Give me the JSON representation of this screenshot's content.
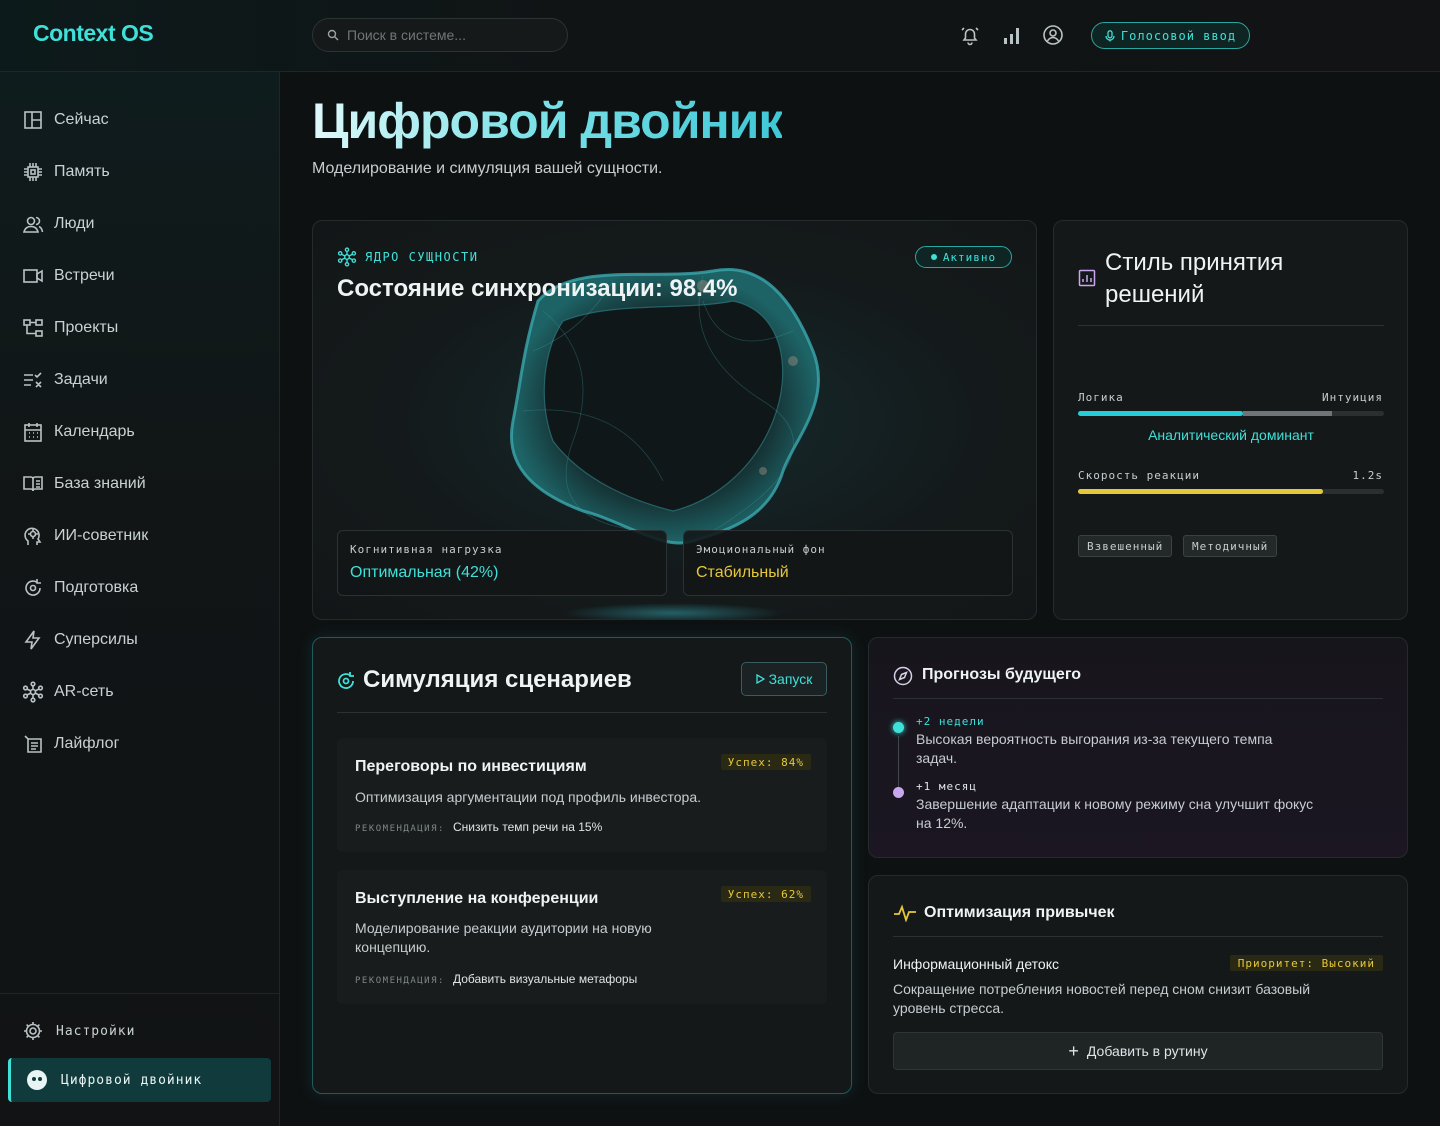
{
  "app": {
    "logo": "Context OS"
  },
  "header": {
    "search_placeholder": "Поиск в системе...",
    "voice_label": "Голосовой ввод"
  },
  "sidebar": {
    "items": [
      {
        "label": "Сейчас",
        "icon": "layout-icon"
      },
      {
        "label": "Память",
        "icon": "chip-icon"
      },
      {
        "label": "Люди",
        "icon": "people-icon"
      },
      {
        "label": "Встречи",
        "icon": "video-icon"
      },
      {
        "label": "Проекты",
        "icon": "hierarchy-icon"
      },
      {
        "label": "Задачи",
        "icon": "tasks-icon"
      },
      {
        "label": "Календарь",
        "icon": "calendar-icon"
      },
      {
        "label": "База знаний",
        "icon": "book-icon"
      },
      {
        "label": "ИИ-советник",
        "icon": "ai-head-icon"
      },
      {
        "label": "Подготовка",
        "icon": "refresh-icon"
      },
      {
        "label": "Суперсилы",
        "icon": "bolt-icon"
      },
      {
        "label": "AR-сеть",
        "icon": "network-icon"
      },
      {
        "label": "Лайфлог",
        "icon": "log-icon"
      }
    ],
    "settings": "Настройки",
    "active": "Цифровой двойник"
  },
  "page": {
    "title": "Цифровой двойник",
    "subtitle": "Моделирование и симуляция вашей сущности."
  },
  "core": {
    "label": "ЯДРО СУЩНОСТИ",
    "status": "Активно",
    "sync": "Состояние синхронизации: 98.4%",
    "metrics": [
      {
        "label": "Когнитивная нагрузка",
        "value": "Оптимальная (42%)",
        "color": "#3fe0d8"
      },
      {
        "label": "Эмоциональный фон",
        "value": "Стабильный",
        "color": "#e7c73a"
      }
    ]
  },
  "decision": {
    "title": "Стиль принятия решений",
    "left_label": "Логика",
    "right_label": "Интуиция",
    "logic_fraction": 0.54,
    "dominant": "Аналитический доминант",
    "speed_label": "Скорость реакции",
    "speed_value": "1.2s",
    "speed_fraction": 0.8,
    "tags": [
      "Взвешенный",
      "Методичный"
    ]
  },
  "simulation": {
    "title": "Симуляция сценариев",
    "run_label": "Запуск",
    "rec_key": "РЕКОМЕНДАЦИЯ:",
    "scenarios": [
      {
        "title": "Переговоры по инвестициям",
        "success": "Успех: 84%",
        "desc": "Оптимизация аргументации под профиль инвестора.",
        "rec": "Снизить темп речи на 15%"
      },
      {
        "title": "Выступление на конференции",
        "success": "Успех: 62%",
        "desc": "Моделирование реакции аудитории на новую концепцию.",
        "rec": "Добавить визуальные метафоры"
      }
    ]
  },
  "forecast": {
    "title": "Прогнозы будущего",
    "items": [
      {
        "when": "+2 недели",
        "text": "Высокая вероятность выгорания из-за текущего темпа задач.",
        "color": "#3fe0d8"
      },
      {
        "when": "+1 месяц",
        "text": "Завершение адаптации к новому режиму сна улучшит фокус на 12%.",
        "color": "#c9a6f0"
      }
    ]
  },
  "habits": {
    "title": "Оптимизация привычек",
    "name": "Информационный детокс",
    "priority": "Приоритет: Высокий",
    "desc": "Сокращение потребления новостей перед сном снизит базовый уровень стресса.",
    "add_label": "Добавить в рутину"
  },
  "colors": {
    "accent": "#3fe0d8",
    "warning": "#e7c73a",
    "violet": "#c9a6f0"
  }
}
